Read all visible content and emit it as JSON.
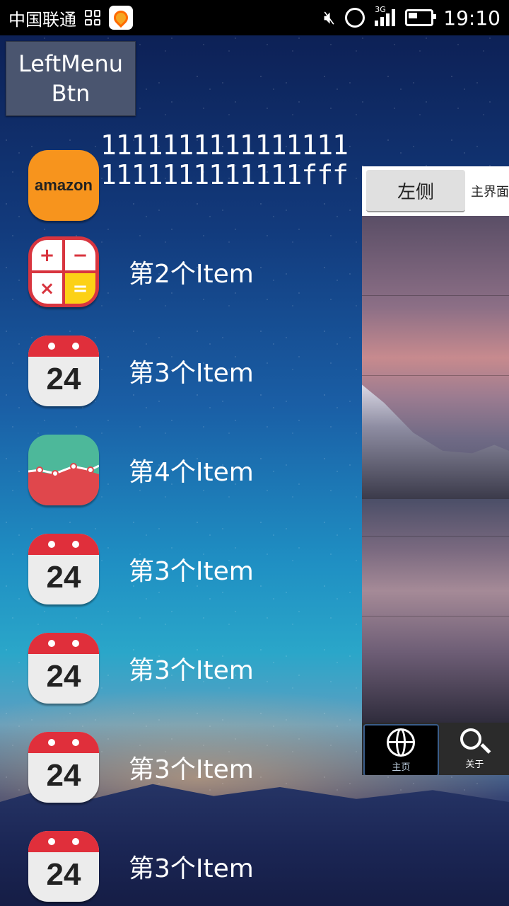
{
  "status_bar": {
    "carrier": "中国联通",
    "network": "3G",
    "time": "19:10"
  },
  "menu_button": {
    "label": "LeftMenu Btn"
  },
  "header_text": "11111111111111111111111111111fff",
  "menu_items": [
    {
      "icon": "amazon-icon",
      "label": ""
    },
    {
      "icon": "calculator-icon",
      "label": "第2个Item"
    },
    {
      "icon": "calendar-icon",
      "label": "第3个Item",
      "icon_text": "24"
    },
    {
      "icon": "chart-icon",
      "label": "第4个Item"
    },
    {
      "icon": "calendar-icon",
      "label": "第3个Item",
      "icon_text": "24"
    },
    {
      "icon": "calendar-icon",
      "label": "第3个Item",
      "icon_text": "24"
    },
    {
      "icon": "calendar-icon",
      "label": "第3个Item",
      "icon_text": "24"
    },
    {
      "icon": "calendar-icon",
      "label": "第3个Item",
      "icon_text": "24"
    }
  ],
  "amazon_logo_text": "amazon",
  "content": {
    "left_button": "左侧",
    "title": "主界面",
    "tabs": [
      {
        "label": "主页",
        "icon": "globe-icon"
      },
      {
        "label": "关于",
        "icon": "search-icon"
      }
    ]
  }
}
